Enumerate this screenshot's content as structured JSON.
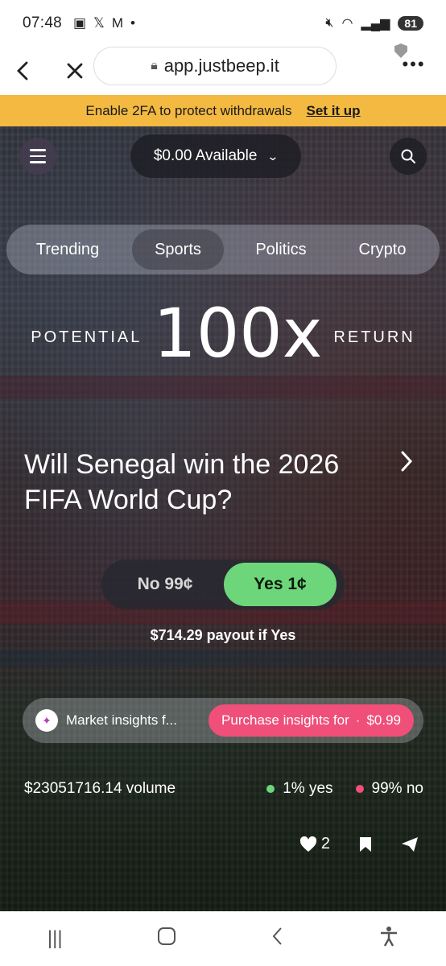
{
  "status_bar": {
    "time": "07:48",
    "battery": "81",
    "notif_icons": [
      "screenshot-icon",
      "x-icon",
      "gmail-icon",
      "dot-icon"
    ]
  },
  "browser": {
    "url": "app.justbeep.it",
    "menu": "•••"
  },
  "banner": {
    "message": "Enable 2FA to protect withdrawals",
    "action": "Set it up"
  },
  "header": {
    "balance": "$0.00 Available"
  },
  "tabs": [
    {
      "label": "Trending",
      "active": false
    },
    {
      "label": "Sports",
      "active": true
    },
    {
      "label": "Politics",
      "active": false
    },
    {
      "label": "Crypto",
      "active": false
    }
  ],
  "promo": {
    "left": "POTENTIAL",
    "multiplier": "100x",
    "right": "RETURN"
  },
  "market": {
    "question": "Will Senegal win the 2026 FIFA World Cup?",
    "no_label": "No 99¢",
    "yes_label": "Yes 1¢",
    "payout": "$714.29 payout if Yes",
    "insights_label": "Market insights f...",
    "insights_button": "Purchase insights for",
    "insights_price": "$0.99",
    "volume": "$23051716.14 volume",
    "yes_pct": "1% yes",
    "no_pct": "99% no",
    "likes": "2"
  },
  "colors": {
    "banner": "#f3b941",
    "yes": "#6ed67a",
    "no": "#ef4f79",
    "insights_button": "#ef4f79"
  }
}
